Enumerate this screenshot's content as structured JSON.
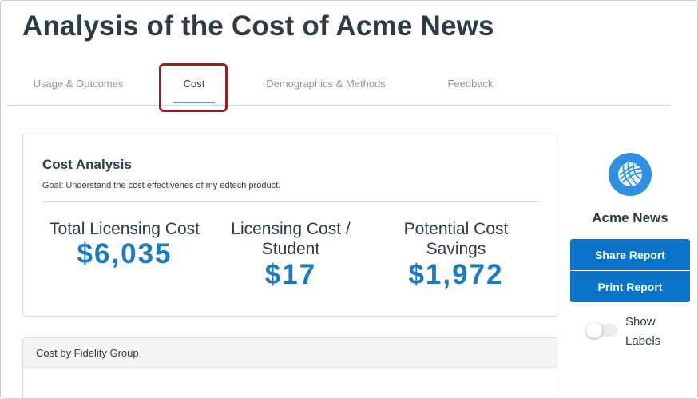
{
  "page": {
    "title": "Analysis of the Cost of Acme News"
  },
  "tabs": [
    {
      "label": "Usage & Outcomes",
      "active": false
    },
    {
      "label": "Cost",
      "active": true
    },
    {
      "label": "Demographics & Methods",
      "active": false
    },
    {
      "label": "Feedback",
      "active": false
    }
  ],
  "cost_analysis": {
    "title": "Cost Analysis",
    "goal": "Goal: Understand the cost effectivenes of my edtech product.",
    "metrics": [
      {
        "label": "Total Licensing Cost",
        "value": "$6,035"
      },
      {
        "label": "Licensing Cost / Student",
        "value": "$17"
      },
      {
        "label": "Potential Cost Savings",
        "value": "$1,972"
      }
    ]
  },
  "fidelity": {
    "title": "Cost by Fidelity Group"
  },
  "sidebar": {
    "product_name": "Acme News",
    "logo_icon": "globe-icon",
    "share_label": "Share Report",
    "print_label": "Print Report",
    "show_labels": {
      "label_line1": "Show",
      "label_line2": "Labels",
      "enabled": false
    }
  },
  "colors": {
    "accent_blue": "#1a7ac4",
    "button_blue": "#0b74c8",
    "highlight_red": "#9b1c20",
    "tab_underline": "#5ba3c6"
  }
}
